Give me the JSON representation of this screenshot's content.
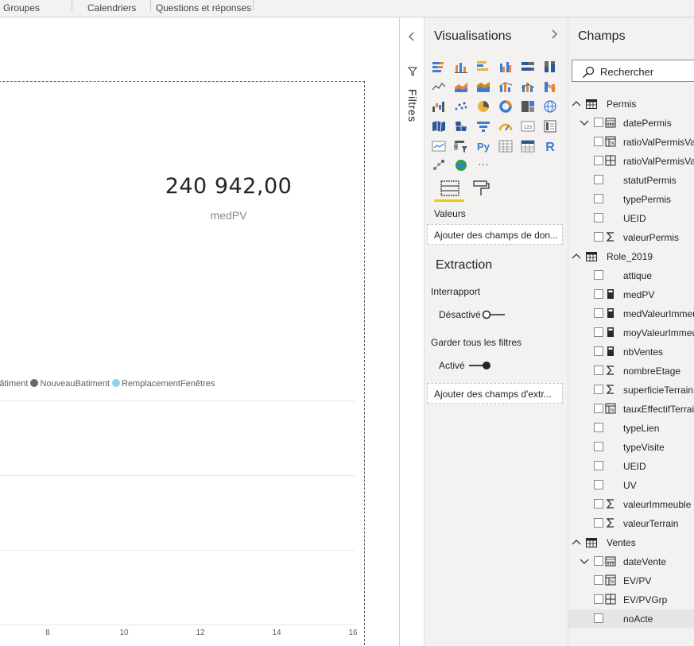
{
  "ribbon": {
    "groups": [
      "Groupes",
      "Calendriers",
      "Questions et réponses"
    ]
  },
  "canvas": {
    "card": {
      "value": "240 942,00",
      "label": "medPV"
    },
    "legend": [
      {
        "label": "Bâtiment",
        "color": "#252423"
      },
      {
        "label": "NouveauBatiment",
        "color": "#5f6b6d"
      },
      {
        "label": "RemplacementFenêtres",
        "color": "#8ad4eb"
      }
    ],
    "x_ticks": [
      "8",
      "10",
      "12",
      "14",
      "16"
    ]
  },
  "filters": {
    "label": "Filtres"
  },
  "visualizations": {
    "title": "Visualisations",
    "tabs": [
      "fields-tab-icon",
      "format-paintroller-icon"
    ],
    "values_label": "Valeurs",
    "values_placeholder": "Ajouter des champs de don...",
    "more_label": "···",
    "py_label": "Py",
    "r_label": "R",
    "extraction": {
      "title": "Extraction",
      "cross_report_label": "Interrapport",
      "cross_report_state": "Désactivé",
      "keep_filters_label": "Garder tous les filtres",
      "keep_filters_state": "Activé",
      "placeholder": "Ajouter des champs d'extr..."
    }
  },
  "fields": {
    "title": "Champs",
    "search_placeholder": "Rechercher",
    "tables": [
      {
        "name": "Permis",
        "fields": [
          {
            "name": "datePermis",
            "icon": "calendar-icon",
            "expandable": true
          },
          {
            "name": "ratioValPermisVa",
            "icon": "calculated-column-icon"
          },
          {
            "name": "ratioValPermisVa",
            "icon": "calculated-grid-icon"
          },
          {
            "name": "statutPermis",
            "icon": ""
          },
          {
            "name": "typePermis",
            "icon": ""
          },
          {
            "name": "UEID",
            "icon": ""
          },
          {
            "name": "valeurPermis",
            "icon": "sigma-icon"
          }
        ]
      },
      {
        "name": "Role_2019",
        "fields": [
          {
            "name": "attique",
            "icon": ""
          },
          {
            "name": "medPV",
            "icon": "measure-icon"
          },
          {
            "name": "medValeurImmeu",
            "icon": "measure-icon"
          },
          {
            "name": "moyValeurImmeu",
            "icon": "measure-icon"
          },
          {
            "name": "nbVentes",
            "icon": "measure-icon"
          },
          {
            "name": "nombreEtage",
            "icon": "sigma-icon"
          },
          {
            "name": "superficieTerrain",
            "icon": "sigma-icon"
          },
          {
            "name": "tauxEffectifTerrai",
            "icon": "calculated-column-icon"
          },
          {
            "name": "typeLien",
            "icon": ""
          },
          {
            "name": "typeVisite",
            "icon": ""
          },
          {
            "name": "UEID",
            "icon": ""
          },
          {
            "name": "UV",
            "icon": ""
          },
          {
            "name": "valeurImmeuble",
            "icon": "sigma-icon"
          },
          {
            "name": "valeurTerrain",
            "icon": "sigma-icon"
          }
        ]
      },
      {
        "name": "Ventes",
        "fields": [
          {
            "name": "dateVente",
            "icon": "calendar-icon",
            "expandable": true
          },
          {
            "name": "EV/PV",
            "icon": "calculated-column-icon"
          },
          {
            "name": "EV/PVGrp",
            "icon": "calculated-grid-icon"
          },
          {
            "name": "noActe",
            "icon": ""
          }
        ]
      }
    ]
  },
  "colors": {
    "accent": "#f2c811",
    "pane": "#f3f2f1"
  }
}
